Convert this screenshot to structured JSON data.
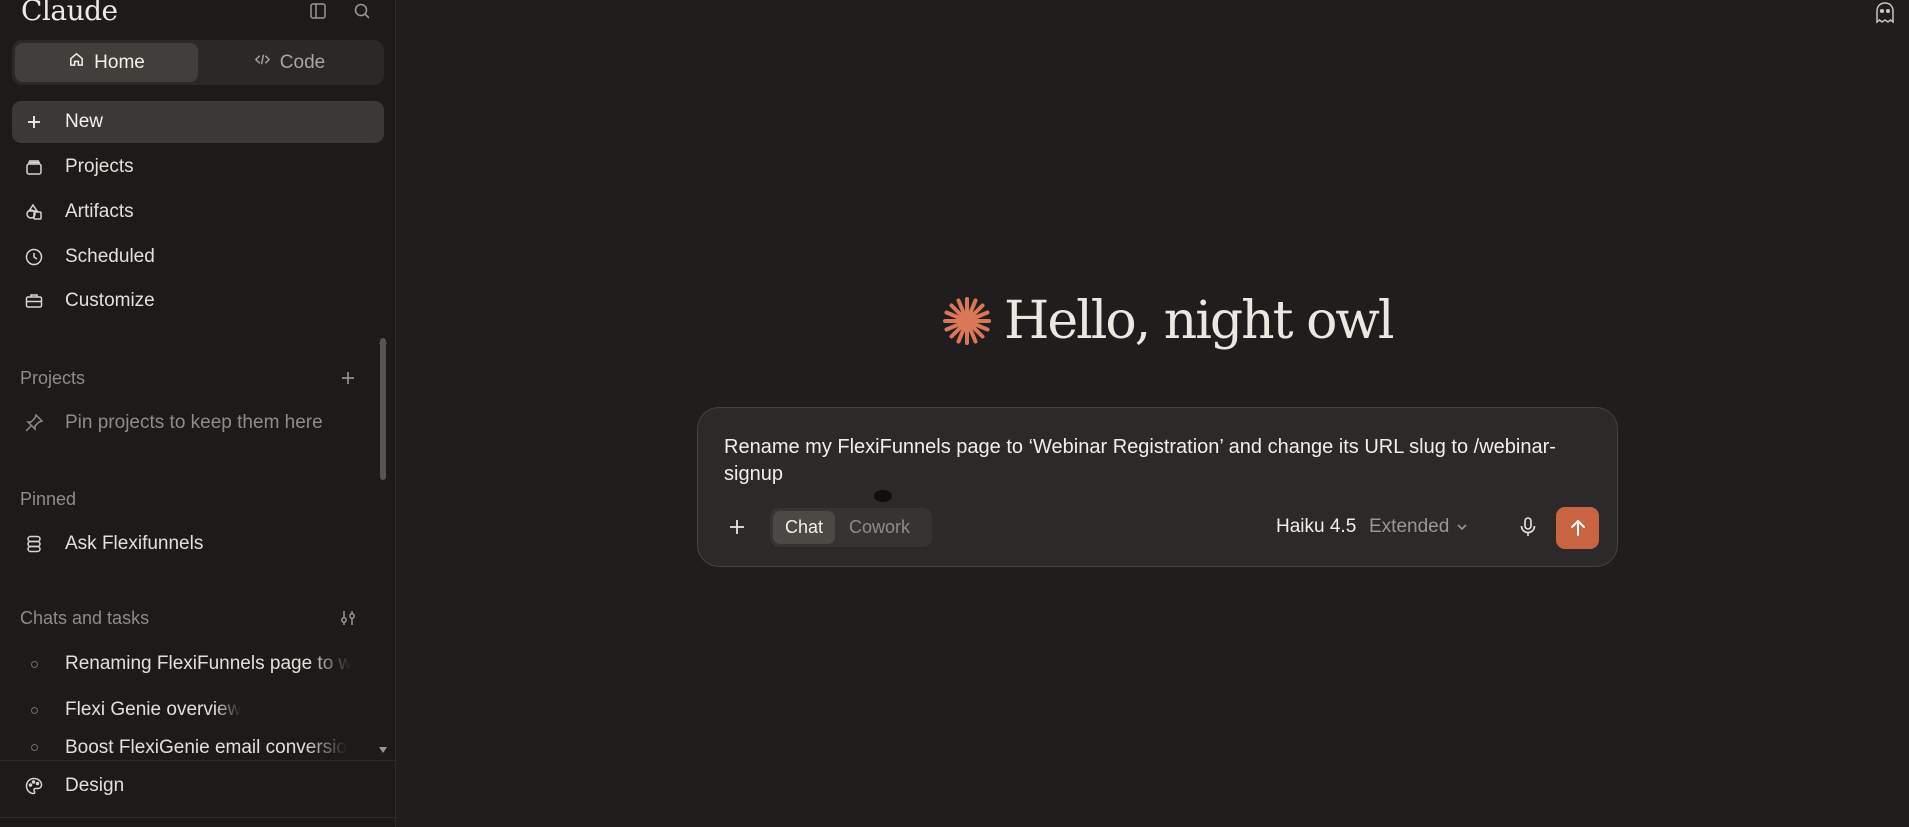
{
  "sidebar": {
    "brand": "Claude",
    "tabs": [
      {
        "label": "Home",
        "icon": "home-icon",
        "active": true
      },
      {
        "label": "Code",
        "icon": "code-icon",
        "active": false
      }
    ],
    "nav": [
      {
        "label": "New",
        "icon": "plus-icon",
        "active": true
      },
      {
        "label": "Projects",
        "icon": "projects-icon"
      },
      {
        "label": "Artifacts",
        "icon": "artifacts-icon"
      },
      {
        "label": "Scheduled",
        "icon": "clock-icon"
      },
      {
        "label": "Customize",
        "icon": "briefcase-icon"
      }
    ],
    "projects_section": {
      "title": "Projects",
      "placeholder": "Pin projects to keep them here"
    },
    "pinned_section": {
      "title": "Pinned",
      "items": [
        {
          "label": "Ask Flexifunnels",
          "icon": "stack-icon"
        }
      ]
    },
    "chats_section": {
      "title": "Chats and tasks",
      "items": [
        {
          "label": "Renaming FlexiFunnels page to w"
        },
        {
          "label": "Flexi Genie overview"
        },
        {
          "label": "Boost FlexiGenie email conversio"
        }
      ]
    },
    "bottom_item": {
      "label": "Design",
      "icon": "palette-icon"
    }
  },
  "main": {
    "greeting": "Hello, night owl",
    "composer": {
      "prompt": "Rename my FlexiFunnels page to ‘Webinar Registration’ and change its URL slug to /webinar-signup",
      "modes": [
        {
          "label": "Chat",
          "active": true
        },
        {
          "label": "Cowork",
          "active": false
        }
      ],
      "model_name": "Haiku 4.5",
      "model_mode": "Extended"
    }
  },
  "colors": {
    "background": "#1f1e1d",
    "sidebar": "#1c1b1a",
    "accent": "#c96442",
    "composer": "#2b2a28"
  }
}
